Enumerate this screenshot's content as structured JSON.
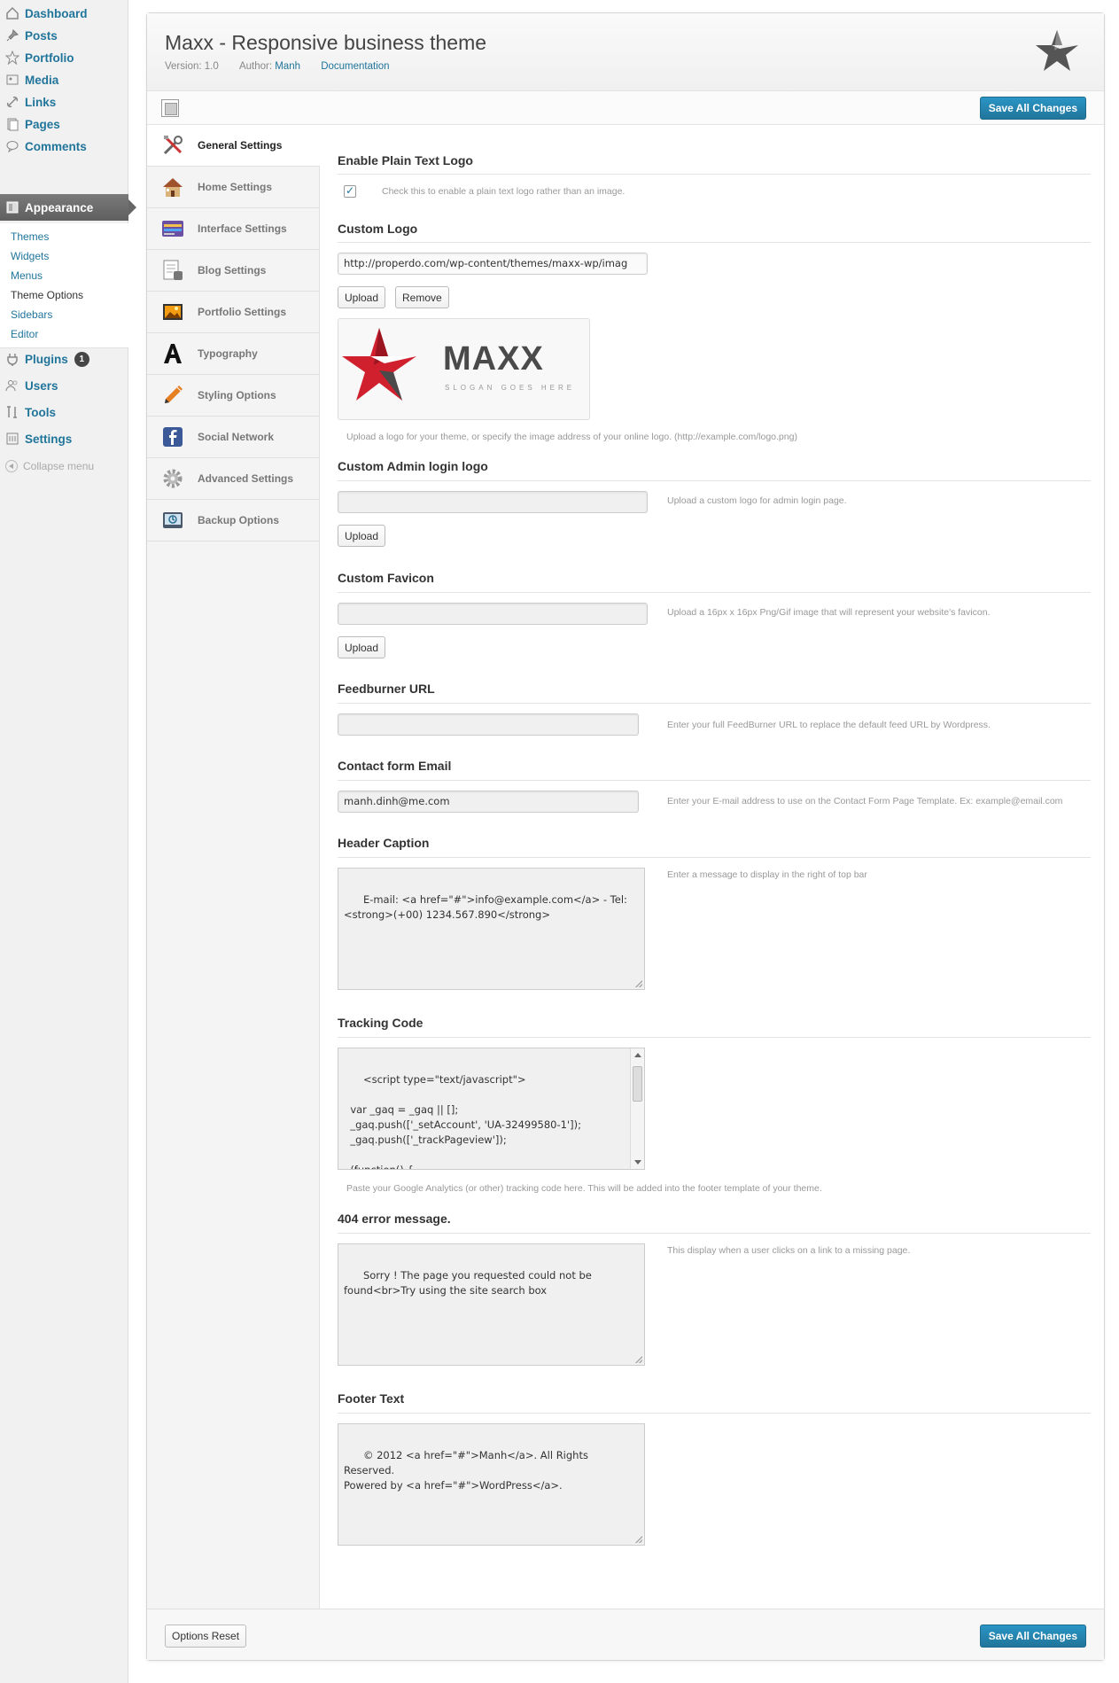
{
  "admin_menu": {
    "items": [
      {
        "label": "Dashboard",
        "icon": "dashboard-icon"
      },
      {
        "label": "Posts",
        "icon": "pin-icon"
      },
      {
        "label": "Portfolio",
        "icon": "star-icon"
      },
      {
        "label": "Media",
        "icon": "media-icon"
      },
      {
        "label": "Links",
        "icon": "link-icon"
      },
      {
        "label": "Pages",
        "icon": "pages-icon"
      },
      {
        "label": "Comments",
        "icon": "comments-icon"
      },
      {
        "label": "Appearance",
        "icon": "appearance-icon"
      },
      {
        "label": "Plugins",
        "icon": "plugin-icon",
        "badge": "1"
      },
      {
        "label": "Users",
        "icon": "users-icon"
      },
      {
        "label": "Tools",
        "icon": "tools-icon"
      },
      {
        "label": "Settings",
        "icon": "settings-icon"
      }
    ],
    "appearance_submenu": [
      "Themes",
      "Widgets",
      "Menus",
      "Theme Options",
      "Sidebars",
      "Editor"
    ],
    "collapse_label": "Collapse menu"
  },
  "header": {
    "title": "Maxx - Responsive business theme",
    "version": "Version: 1.0",
    "author_prefix": "Author:",
    "author": "Manh",
    "documentation": "Documentation",
    "save_label": "Save All Changes"
  },
  "nav": [
    {
      "label": "General Settings",
      "icon": "tools-icon"
    },
    {
      "label": "Home Settings",
      "icon": "house-icon"
    },
    {
      "label": "Interface Settings",
      "icon": "interface-icon"
    },
    {
      "label": "Blog Settings",
      "icon": "blog-icon"
    },
    {
      "label": "Portfolio Settings",
      "icon": "picture-icon"
    },
    {
      "label": "Typography",
      "icon": "typography-icon"
    },
    {
      "label": "Styling Options",
      "icon": "pencil-icon"
    },
    {
      "label": "Social Network",
      "icon": "facebook-icon"
    },
    {
      "label": "Advanced Settings",
      "icon": "gear-icon"
    },
    {
      "label": "Backup Options",
      "icon": "backup-icon"
    }
  ],
  "sections": {
    "plain_logo": {
      "title": "Enable Plain Text Logo",
      "desc": "Check this to enable a plain text logo rather than an image."
    },
    "custom_logo": {
      "title": "Custom Logo",
      "value": "http://properdo.com/wp-content/themes/maxx-wp/imag",
      "upload": "Upload",
      "remove": "Remove",
      "logo_text": "MAXX",
      "slogan": "SLOGAN GOES HERE",
      "desc": "Upload a logo for your theme, or specify the image address of your online logo. (http://example.com/logo.png)"
    },
    "admin_logo": {
      "title": "Custom Admin login logo",
      "upload": "Upload",
      "desc": "Upload a custom logo for admin login page."
    },
    "favicon": {
      "title": "Custom Favicon",
      "upload": "Upload",
      "desc": "Upload a 16px x 16px Png/Gif image that will represent your website's favicon."
    },
    "feedburner": {
      "title": "Feedburner URL",
      "desc": "Enter your full FeedBurner URL to replace the default feed URL by Wordpress."
    },
    "contact_email": {
      "title": "Contact form Email",
      "value": "manh.dinh@me.com",
      "desc": "Enter your E-mail address to use on the Contact Form Page Template. Ex: example@email.com"
    },
    "header_caption": {
      "title": "Header Caption",
      "value": "E-mail: <a href=\"#\">info@example.com</a> - Tel:\n<strong>(+00) 1234.567.890</strong>",
      "desc": "Enter a message to display in the right of top bar"
    },
    "tracking": {
      "title": "Tracking Code",
      "value": "<script type=\"text/javascript\">\n\n  var _gaq = _gaq || [];\n  _gaq.push(['_setAccount', 'UA-32499580-1']);\n  _gaq.push(['_trackPageview']);\n\n  (function() {\n    var ga = document.createElement('script'); ga.type",
      "desc": "Paste your Google Analytics (or other) tracking code here. This will be added into the footer template of your theme."
    },
    "error404": {
      "title": "404 error message.",
      "value": "Sorry ! The page you requested could not be\nfound<br>Try using the site search box",
      "desc": "This display when a user clicks on a link to a missing page."
    },
    "footer_text": {
      "title": "Footer Text",
      "value": "© 2012 <a href=\"#\">Manh</a>. All Rights Reserved.\nPowered by <a href=\"#\">WordPress</a>."
    }
  },
  "footer": {
    "reset_label": "Options Reset",
    "save_label": "Save All Changes"
  },
  "colors": {
    "link": "#21759b",
    "logo_red": "#d0202e",
    "logo_gray": "#4a4a4a"
  }
}
